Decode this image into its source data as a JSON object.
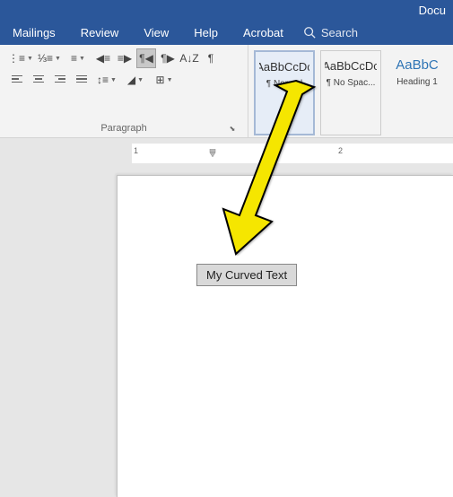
{
  "titlebar": {
    "doc_title": "Docu"
  },
  "tabs": {
    "mailings": "Mailings",
    "review": "Review",
    "view": "View",
    "help": "Help",
    "acrobat": "Acrobat",
    "search_placeholder": "Search"
  },
  "paragraph_group": {
    "label": "Paragraph"
  },
  "styles": {
    "preview_text": "AaBbCcDc",
    "heading_preview": "AaBbC",
    "normal": "¶ Normal",
    "no_spacing": "¶ No Spac...",
    "heading1": "Heading 1"
  },
  "ruler": {
    "mark1": "1",
    "mark2": "2"
  },
  "document": {
    "selected_text": "My Curved Text"
  }
}
